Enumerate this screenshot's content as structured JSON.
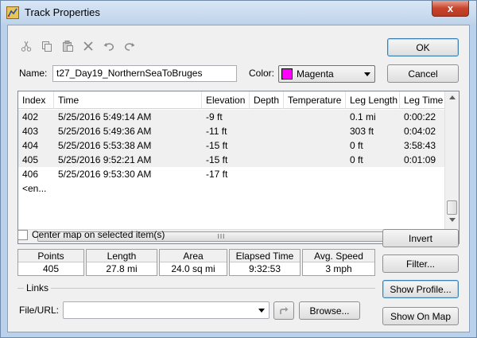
{
  "window": {
    "title": "Track Properties",
    "close_glyph": "x",
    "accent": "#c7432c"
  },
  "toolbar": {
    "icons": [
      "cut-icon",
      "copy-icon",
      "paste-icon",
      "delete-icon",
      "undo-icon",
      "redo-icon"
    ]
  },
  "buttons": {
    "ok": "OK",
    "cancel": "Cancel",
    "invert": "Invert",
    "filter": "Filter...",
    "show_profile": "Show Profile...",
    "show_on_map": "Show On Map",
    "browse": "Browse..."
  },
  "form": {
    "name_label": "Name:",
    "name_value": "t27_Day19_NorthernSeaToBruges",
    "color_label": "Color:",
    "color_value": "Magenta",
    "color_hex": "#ff00ff"
  },
  "grid": {
    "columns": [
      "Index",
      "Time",
      "Elevation",
      "Depth",
      "Temperature",
      "Leg Length",
      "Leg Time"
    ],
    "rows": [
      {
        "index": "402",
        "time": "5/25/2016 5:49:14 AM",
        "elevation": "-9 ft",
        "depth": "",
        "temperature": "",
        "leg_length": "0.1 mi",
        "leg_time": "0:00:22",
        "selected": true
      },
      {
        "index": "403",
        "time": "5/25/2016 5:49:36 AM",
        "elevation": "-11 ft",
        "depth": "",
        "temperature": "",
        "leg_length": "303 ft",
        "leg_time": "0:04:02",
        "selected": true
      },
      {
        "index": "404",
        "time": "5/25/2016 5:53:38 AM",
        "elevation": "-15 ft",
        "depth": "",
        "temperature": "",
        "leg_length": "0 ft",
        "leg_time": "3:58:43",
        "selected": true
      },
      {
        "index": "405",
        "time": "5/25/2016 9:52:21 AM",
        "elevation": "-15 ft",
        "depth": "",
        "temperature": "",
        "leg_length": "0 ft",
        "leg_time": "0:01:09",
        "selected": true
      },
      {
        "index": "406",
        "time": "5/25/2016 9:53:30 AM",
        "elevation": "-17 ft",
        "depth": "",
        "temperature": "",
        "leg_length": "",
        "leg_time": "",
        "selected": false
      },
      {
        "index": "<en...",
        "time": "",
        "elevation": "",
        "depth": "",
        "temperature": "",
        "leg_length": "",
        "leg_time": "",
        "selected": false
      }
    ],
    "hscroll_grip": "III"
  },
  "center_map": {
    "label": "Center map on selected item(s)",
    "checked": false
  },
  "stats": [
    {
      "label": "Points",
      "value": "405"
    },
    {
      "label": "Length",
      "value": "27.8 mi"
    },
    {
      "label": "Area",
      "value": "24.0 sq mi"
    },
    {
      "label": "Elapsed Time",
      "value": "9:32:53"
    },
    {
      "label": "Avg. Speed",
      "value": "3 mph"
    }
  ],
  "links": {
    "group_label": "Links",
    "file_label": "File/URL:",
    "file_value": ""
  }
}
